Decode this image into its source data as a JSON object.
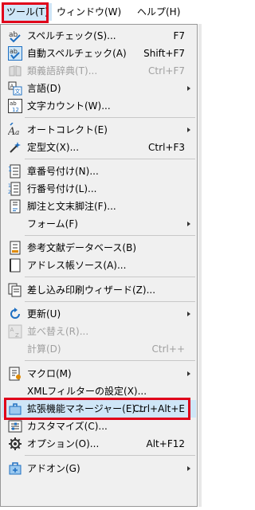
{
  "menubar": {
    "tools": "ツール(T)",
    "window": "ウィンドウ(W)",
    "help": "ヘルプ(H)"
  },
  "menu": {
    "spelling": {
      "label": "スペルチェック(S)...",
      "shortcut": "F7"
    },
    "auto_spell": {
      "label": "自動スペルチェック(A)",
      "shortcut": "Shift+F7"
    },
    "thesaurus": {
      "label": "類義語辞典(T)...",
      "shortcut": "Ctrl+F7"
    },
    "language": {
      "label": "言語(D)"
    },
    "word_count": {
      "label": "文字カウント(W)..."
    },
    "autocorrect": {
      "label": "オートコレクト(E)"
    },
    "autotext": {
      "label": "定型文(X)...",
      "shortcut": "Ctrl+F3"
    },
    "chapter_numbering": {
      "label": "章番号付け(N)..."
    },
    "line_numbering": {
      "label": "行番号付け(L)..."
    },
    "footnotes": {
      "label": "脚注と文末脚注(F)..."
    },
    "forms": {
      "label": "フォーム(F)"
    },
    "bibliography": {
      "label": "参考文献データベース(B)"
    },
    "address_book": {
      "label": "アドレス帳ソース(A)..."
    },
    "mail_merge": {
      "label": "差し込み印刷ウィザード(Z)..."
    },
    "update": {
      "label": "更新(U)"
    },
    "sort": {
      "label": "並べ替え(R)..."
    },
    "calculate": {
      "label": "計算(D)",
      "shortcut": "Ctrl++"
    },
    "macros": {
      "label": "マクロ(M)"
    },
    "xml_filter": {
      "label": "XMLフィルターの設定(X)..."
    },
    "extension_manager": {
      "label": "拡張機能マネージャー(E)...",
      "shortcut": "Ctrl+Alt+E"
    },
    "customize": {
      "label": "カスタマイズ(C)..."
    },
    "options": {
      "label": "オプション(O)...",
      "shortcut": "Alt+F12"
    },
    "addons": {
      "label": "アドオン(G)"
    }
  },
  "colors": {
    "highlight_border": "#e0001a",
    "hover_bg": "#cfe6f7",
    "icon_blue": "#1e6fc2"
  }
}
